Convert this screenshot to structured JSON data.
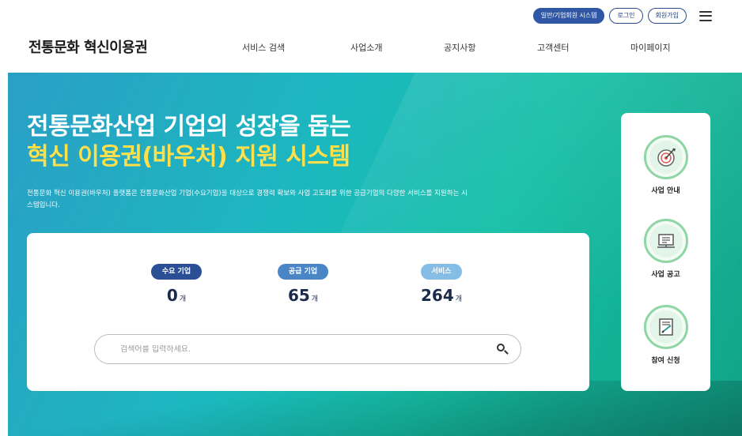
{
  "util": {
    "join_label": "일반/기업회원 시스템",
    "login_label": "로그인",
    "signup_label": "회원가입"
  },
  "header": {
    "logo": "전통문화 혁신이용권",
    "nav": [
      {
        "label": "서비스 검색"
      },
      {
        "label": "사업소개"
      },
      {
        "label": "공지사항"
      },
      {
        "label": "고객센터"
      },
      {
        "label": "마이페이지"
      }
    ]
  },
  "hero": {
    "title_line1": "전통문화산업 기업의 성장을 돕는",
    "title_line2": "혁신 이용권(바우처) 지원 시스템",
    "description": "전통문화 혁신 이용권(바우처) 플랫폼은 전통문화산업 기업(수요기업)을 대상으로 경쟁력 확보와 사업 고도화를 위한 공급기업의 다양한 서비스를 지원하는 시스템입니다."
  },
  "stats": [
    {
      "label": "수요 기업",
      "value": "0",
      "unit": "개",
      "color": "#2b4f95"
    },
    {
      "label": "공급 기업",
      "value": "65",
      "unit": "개",
      "color": "#4a86c6"
    },
    {
      "label": "서비스",
      "value": "264",
      "unit": "개",
      "color": "#86bde6"
    }
  ],
  "search": {
    "placeholder": "검색어를 입력하세요."
  },
  "quick_menu": [
    {
      "label": "사업 안내",
      "icon": "target-icon"
    },
    {
      "label": "사업 공고",
      "icon": "notice-board-icon"
    },
    {
      "label": "참여 신청",
      "icon": "application-form-icon"
    }
  ],
  "colors": {
    "accent_yellow": "#ffe04a",
    "ring_green": "#8fd6a4",
    "brand_navy": "#2f57a5"
  }
}
